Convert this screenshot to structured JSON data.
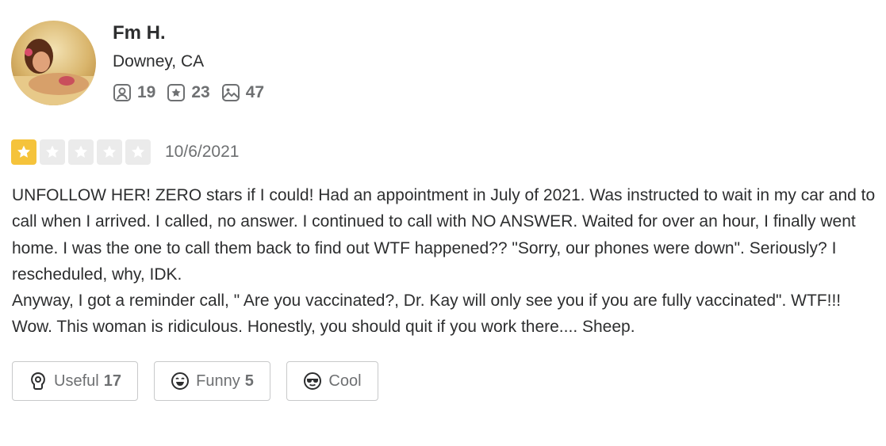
{
  "user": {
    "name": "Fm H.",
    "location": "Downey, CA",
    "stats": [
      {
        "icon": "friends-icon",
        "value": "19"
      },
      {
        "icon": "review-star-icon",
        "value": "23"
      },
      {
        "icon": "photo-icon",
        "value": "47"
      }
    ]
  },
  "review": {
    "rating": 1,
    "rating_max": 5,
    "date": "10/6/2021",
    "paragraphs": [
      "UNFOLLOW HER! ZERO stars if I could! Had an appointment in July of 2021. Was instructed to wait in my car and to call when I arrived. I called, no answer. I continued to call with NO ANSWER. Waited for over an hour, I finally went home. I was the one to call them back to find out WTF happened?? \"Sorry, our phones were down\". Seriously? I rescheduled, why, IDK.",
      "Anyway, I got a reminder call, \" Are you vaccinated?, Dr. Kay will only see you if you are fully vaccinated\". WTF!!! Wow. This woman is ridiculous. Honestly, you should quit if you work there....  Sheep."
    ]
  },
  "actions": {
    "useful": {
      "label": "Useful",
      "count": "17"
    },
    "funny": {
      "label": "Funny",
      "count": "5"
    },
    "cool": {
      "label": "Cool",
      "count": ""
    }
  },
  "colors": {
    "star_filled": "#f5c33b",
    "star_empty": "#ebebeb",
    "text": "#2d2e2f",
    "muted": "#6e7072"
  }
}
